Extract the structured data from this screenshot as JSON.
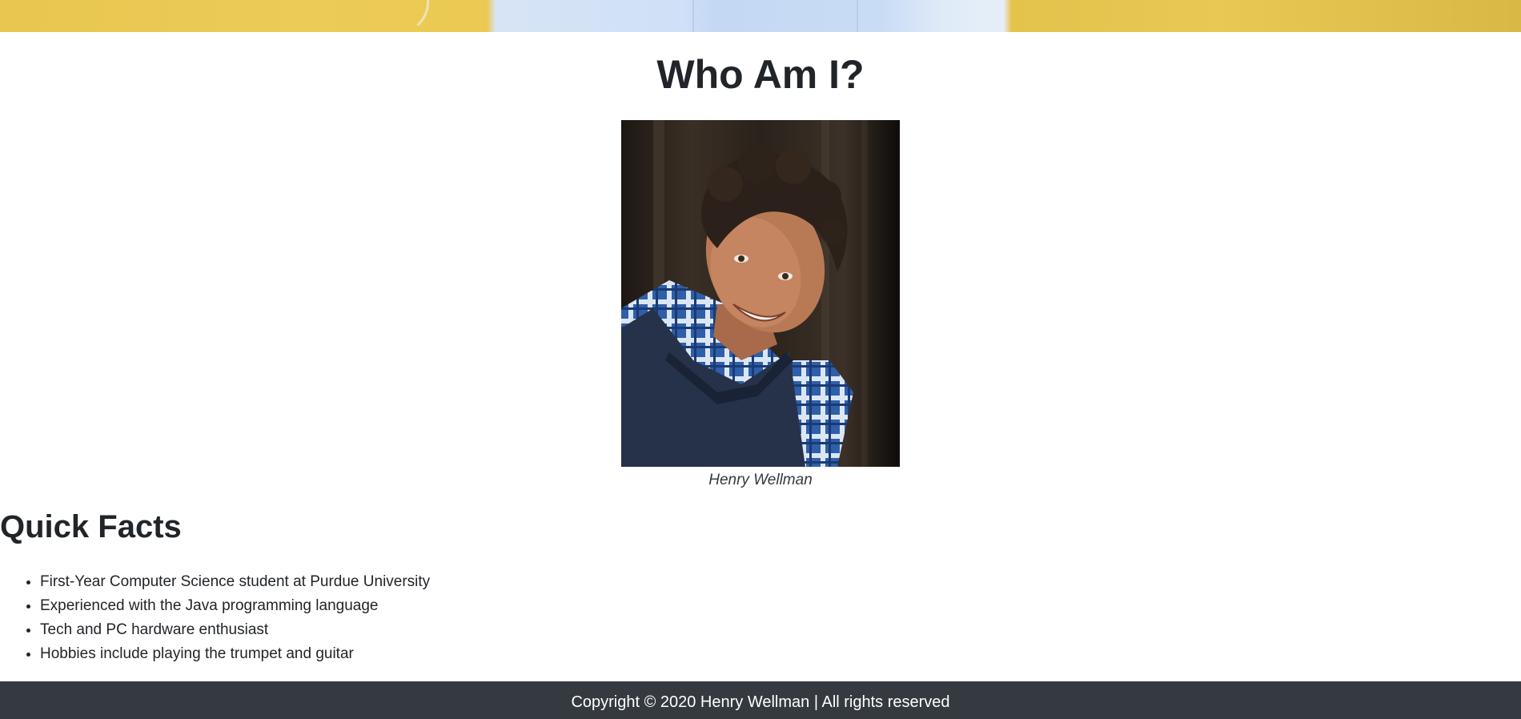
{
  "page": {
    "heading": "Who Am I?",
    "portrait": {
      "caption": "Henry Wellman"
    },
    "quick_facts": {
      "title": "Quick Facts",
      "items": [
        "First-Year Computer Science student at Purdue University",
        "Experienced with the Java programming language",
        "Tech and PC hardware enthusiast",
        "Hobbies include playing the trumpet and guitar"
      ]
    },
    "footer": {
      "copyright": "Copyright © 2020 Henry Wellman | All rights reserved"
    }
  },
  "colors": {
    "footer_background": "#343a40",
    "text": "#212529"
  }
}
